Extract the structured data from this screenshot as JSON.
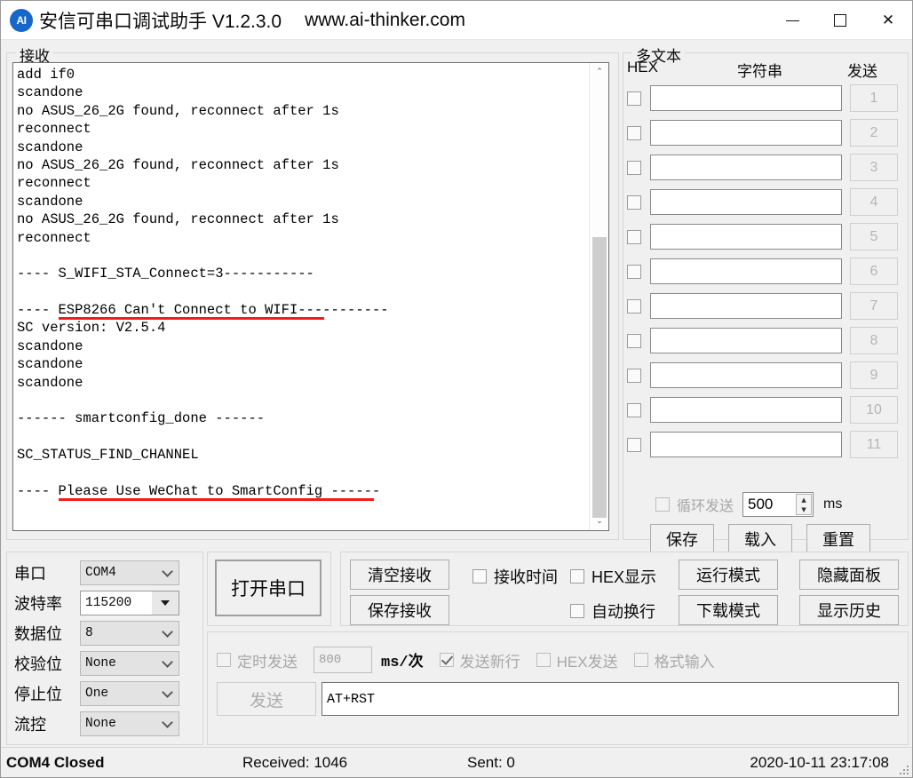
{
  "window": {
    "icon_label": "AI",
    "title": "安信可串口调试助手 V1.2.3.0",
    "url": "www.ai-thinker.com",
    "minimize": "–",
    "maximize": "□",
    "close": "✕"
  },
  "receive": {
    "group_label": "接收",
    "lines": [
      "add if0",
      "scandone",
      "no ASUS_26_2G found, reconnect after 1s",
      "reconnect",
      "scandone",
      "no ASUS_26_2G found, reconnect after 1s",
      "reconnect",
      "scandone",
      "no ASUS_26_2G found, reconnect after 1s",
      "reconnect",
      "",
      "---- S_WIFI_STA_Connect=3-----------",
      "",
      "---- ESP8266 Can't Connect to WIFI-----------",
      "SC version: V2.5.4",
      "scandone",
      "scandone",
      "scandone",
      "",
      "------ smartconfig_done ------",
      "",
      "SC_STATUS_FIND_CHANNEL",
      "",
      "---- Please Use WeChat to SmartConfig ------"
    ],
    "highlight_color": "#f41b1b",
    "scroll_up_icon": "⌃",
    "scroll_down_icon": "⌄"
  },
  "multitext": {
    "group_label": "多文本",
    "col_hex": "HEX",
    "col_string": "字符串",
    "col_send": "发送",
    "rows": [
      {
        "hex_checked": false,
        "value": "",
        "send_label": "1"
      },
      {
        "hex_checked": false,
        "value": "",
        "send_label": "2"
      },
      {
        "hex_checked": false,
        "value": "",
        "send_label": "3"
      },
      {
        "hex_checked": false,
        "value": "",
        "send_label": "4"
      },
      {
        "hex_checked": false,
        "value": "",
        "send_label": "5"
      },
      {
        "hex_checked": false,
        "value": "",
        "send_label": "6"
      },
      {
        "hex_checked": false,
        "value": "",
        "send_label": "7"
      },
      {
        "hex_checked": false,
        "value": "",
        "send_label": "8"
      },
      {
        "hex_checked": false,
        "value": "",
        "send_label": "9"
      },
      {
        "hex_checked": false,
        "value": "",
        "send_label": "10"
      },
      {
        "hex_checked": false,
        "value": "",
        "send_label": "11"
      }
    ],
    "loop_send_label": "循环发送",
    "loop_send_checked": false,
    "loop_interval": "500",
    "loop_unit": "ms",
    "save_label": "保存",
    "load_label": "载入",
    "reset_label": "重置"
  },
  "serial": {
    "fields": [
      {
        "label": "串口",
        "value": "COM4",
        "style": "grey"
      },
      {
        "label": "波特率",
        "value": "115200",
        "style": "white"
      },
      {
        "label": "数据位",
        "value": "8",
        "style": "grey"
      },
      {
        "label": "校验位",
        "value": "None",
        "style": "grey"
      },
      {
        "label": "停止位",
        "value": "One",
        "style": "grey"
      },
      {
        "label": "流控",
        "value": "None",
        "style": "grey"
      }
    ],
    "open_button": "打开串口"
  },
  "controls": {
    "clear_recv": "清空接收",
    "save_recv": "保存接收",
    "recv_time_label": "接收时间",
    "recv_time_checked": false,
    "hex_display_label": "HEX显示",
    "hex_display_checked": false,
    "auto_wrap_label": "自动换行",
    "auto_wrap_checked": false,
    "run_mode": "运行模式",
    "download_mode": "下载模式",
    "hide_panel": "隐藏面板",
    "show_history": "显示历史"
  },
  "send": {
    "timed_send_label": "定时发送",
    "timed_send_checked": false,
    "interval": "800",
    "interval_unit": "ms/次",
    "newline_label": "发送新行",
    "newline_checked": true,
    "hex_send_label": "HEX发送",
    "hex_send_checked": false,
    "format_input_label": "格式输入",
    "format_input_checked": false,
    "send_button": "发送",
    "input_value": "AT+RST"
  },
  "status": {
    "port_state": "COM4 Closed",
    "received": "Received: 1046",
    "sent": "Sent: 0",
    "datetime": "2020-10-11 23:17:08"
  }
}
